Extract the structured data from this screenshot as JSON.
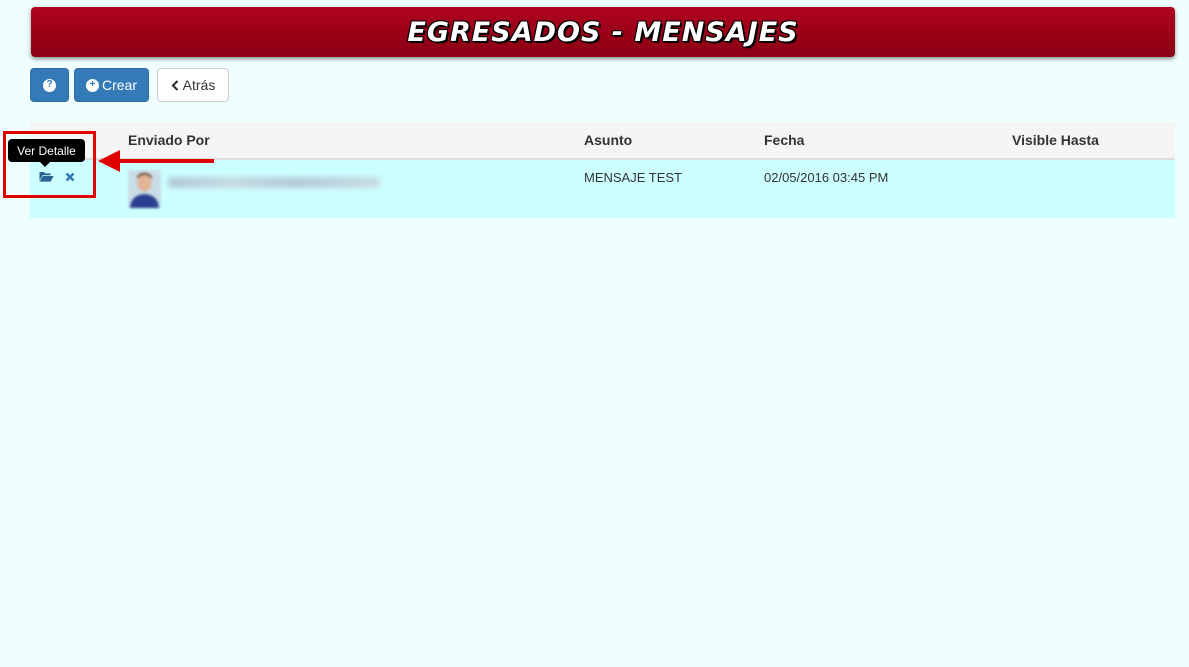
{
  "header": {
    "title": "EGRESADOS - MENSAJES"
  },
  "toolbar": {
    "help_icon": "question-circle-icon",
    "create_label": "Crear",
    "create_icon": "plus-circle-icon",
    "back_label": "Atrás",
    "back_icon": "chevron-left-icon"
  },
  "table": {
    "columns": [
      "Enviado Por",
      "Asunto",
      "Fecha",
      "Visible Hasta"
    ],
    "rows": [
      {
        "subject": "MENSAJE TEST",
        "date": "02/05/2016 03:45 PM",
        "visible_until": ""
      }
    ]
  },
  "tooltip": {
    "text": "Ver Detalle"
  },
  "colors": {
    "banner": "#9a0018",
    "primary": "#337ab7",
    "row_highlight": "#ccffff",
    "page_background": "#efffff",
    "annotation": "#e00000"
  }
}
